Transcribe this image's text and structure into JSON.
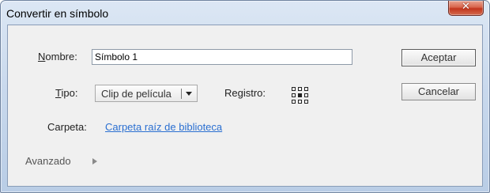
{
  "window": {
    "title": "Convertir en símbolo",
    "close_glyph": "✕"
  },
  "form": {
    "name_label_key": "N",
    "name_label_rest": "ombre:",
    "name_value": "Símbolo 1",
    "type_label_key": "T",
    "type_label_rest": "ipo:",
    "type_selected": "Clip de película",
    "registration_label": "Registro:",
    "registration_selected": "center",
    "folder_label": "Carpeta:",
    "folder_link": "Carpeta raíz de biblioteca",
    "advanced_label": "Avanzado"
  },
  "buttons": {
    "ok": "Aceptar",
    "cancel": "Cancelar"
  },
  "icons": {
    "close": "close-icon",
    "dropdown": "chevron-down-icon",
    "advanced": "triangle-right-icon",
    "registration": "registration-grid-icon"
  }
}
